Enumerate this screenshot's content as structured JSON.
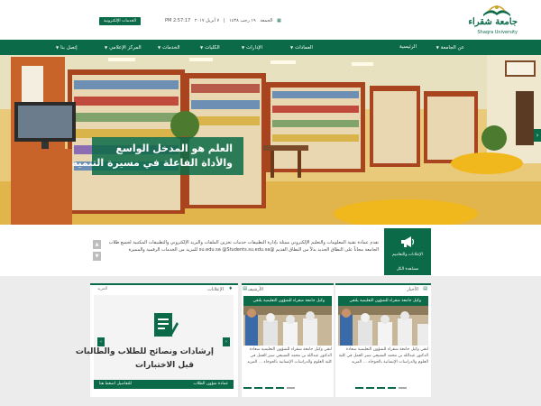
{
  "header": {
    "logo_ar": "جامعة شقراء",
    "logo_en": "Shaqra University",
    "date_day": "الجمعة",
    "date_hijri": "١٩ رجب ١٤٣٨",
    "date_sep": "|",
    "date_greg": "٧ أبريل ٢٠١٧",
    "date_extra": "2:57:17 PM",
    "eservices_label": "الخدمات الإلكترونية"
  },
  "nav": {
    "items": [
      "الرئيسية",
      "عن الجامعة",
      "العمادات",
      "الإدارات",
      "الكليات",
      "الخدمات",
      "المركز الإعلامي",
      "إتصل بنا"
    ]
  },
  "hero": {
    "line1": "العلم هو المدخل الواسع",
    "line2": "والأداة الفاعلة في مسيرة التنمية"
  },
  "news": {
    "label": "الإعلانات والتعاميم",
    "more": "مشاهدة الكل",
    "text": "تقدم عمادة تقنية المعلومات والتعليم الإلكتروني ممثلة بإدارة التطبيقات خدمات تخزين الملفات والبريد الإلكتروني والتطبيقات المكتبية لجميع طلاب الجامعة مجاناً على النطاق الجديد بدلاً من النطاق القديم @su.edu.sa @Students.su.edu.sa للمزيد من الخدمات الرقمية والمميزة"
  },
  "panels": {
    "news_title": "الأخبار",
    "archive_title": "الأرشيف",
    "ads_title": "الإعلانات",
    "more": "المزيد",
    "card_caption": "وكيل جامعة شقراء للشؤون التعليمية يلتقي",
    "card_text": "لتقي وكيل جامعة شقراء للشؤون التعليمية سعادة الدكتور عبدالله بن محمد السبيعي سير العمل في كلية العلوم والدراسات الإنسانية بالجوخاء ... المزيد",
    "guide_line1": "إرشادات ونصائح للطلاب والطالبات",
    "guide_line2": "قبل الاختبارات",
    "guide_footer_right": "عمادة شؤون الطلاب",
    "guide_footer_left": "للتفاصيل اضغط هنا"
  },
  "colors": {
    "brand_green": "#0b6b48"
  }
}
